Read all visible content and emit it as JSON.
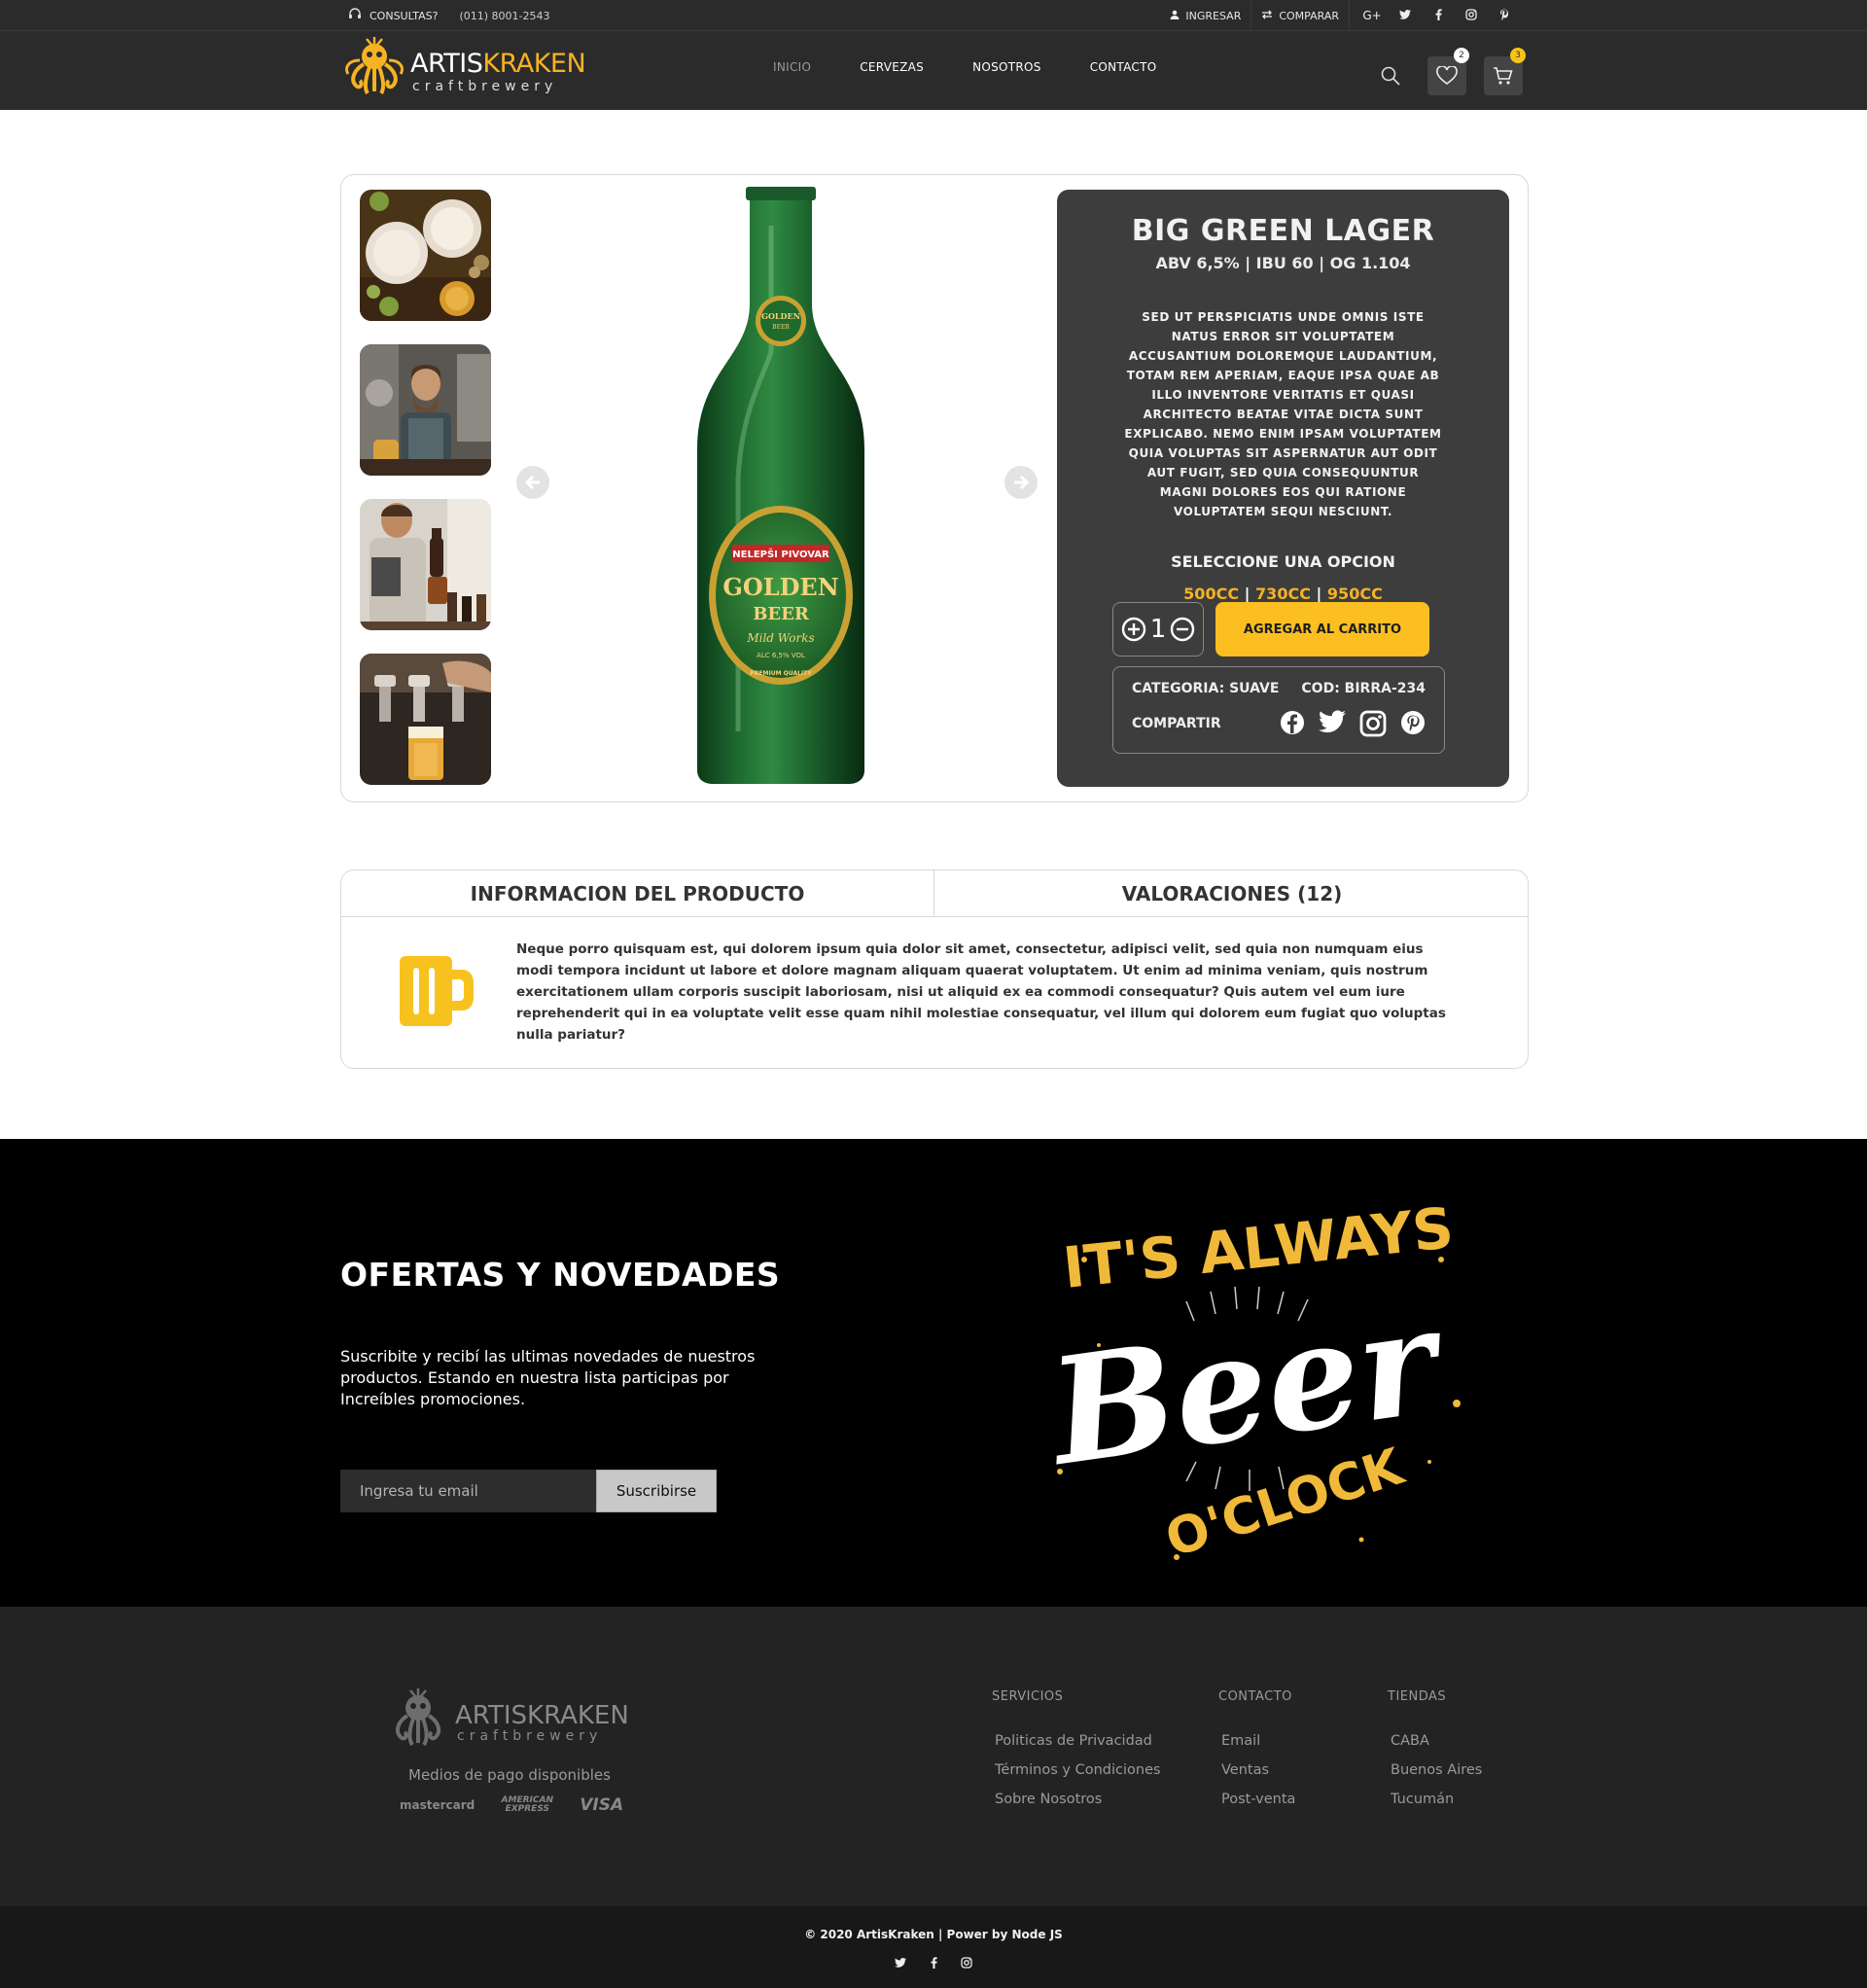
{
  "topbar": {
    "consultas_label": "CONSULTAS?",
    "phone": "(011) 8001-2543",
    "login_label": "INGRESAR",
    "compare_label": "COMPARAR",
    "social": [
      "G+",
      "t",
      "f",
      "ig",
      "p"
    ]
  },
  "header": {
    "logo_part1": "ARTIS",
    "logo_part2": "KRAKEN",
    "logo_sub": "craftbrewery",
    "nav": [
      "INICIO",
      "CERVEZAS",
      "NOSOTROS",
      "CONTACTO"
    ],
    "wishlist_count": "2",
    "cart_count": "3"
  },
  "product": {
    "name": "BIG GREEN LAGER",
    "specs": "ABV 6,5% | IBU 60 | OG 1.104",
    "description": "SED UT PERSPICIATIS UNDE OMNIS ISTE NATUS ERROR SIT VOLUPTATEM ACCUSANTIUM DOLOREMQUE LAUDANTIUM, TOTAM REM APERIAM, EAQUE IPSA QUAE AB ILLO INVENTORE VERITATIS ET QUASI ARCHITECTO BEATAE VITAE DICTA SUNT EXPLICABO. NEMO ENIM IPSAM VOLUPTATEM QUIA VOLUPTAS SIT ASPERNATUR AUT ODIT AUT FUGIT, SED QUIA CONSEQUUNTUR MAGNI DOLORES EOS QUI RATIONE VOLUPTATEM SEQUI NESCIUNT.",
    "option_title": "SELECCIONE UNA OPCION",
    "options": [
      "500CC",
      "730CC",
      "950CC"
    ],
    "option_separator": " | ",
    "quantity": "1",
    "add_to_cart": "AGREGAR AL CARRITO",
    "category": "CATEGORIA: SUAVE",
    "code": "COD: BIRRA-234",
    "share_label": "COMPARTIR",
    "bottle_label": {
      "brand": "GOLDEN",
      "type": "BEER",
      "script": "Mild Works",
      "abv": "ALC 6,5% VOL",
      "banner": "NELEPŠI PIVOVAR",
      "quality": "PREMIUM QUALITY"
    }
  },
  "tabs": {
    "info_label": "INFORMACION DEL PRODUCTO",
    "reviews_label": "VALORACIONES (12)",
    "body": "Neque porro quisquam est, qui dolorem ipsum quia dolor sit amet, consectetur, adipisci velit, sed quia non numquam eius modi tempora incidunt ut labore et dolore magnam aliquam quaerat voluptatem. Ut enim ad minima veniam, quis nostrum exercitationem ullam corporis suscipit laboriosam, nisi ut aliquid ex ea commodi consequatur? Quis autem vel eum iure reprehenderit qui in ea voluptate velit esse quam nihil molestiae consequatur, vel illum qui dolorem eum fugiat quo voluptas nulla pariatur?"
  },
  "newsletter": {
    "title": "OFERTAS Y NOVEDADES",
    "text": "Suscribite y recibí las ultimas novedades de nuestros productos. Estando en nuestra lista participas por Increíbles promociones.",
    "placeholder": "Ingresa tu email",
    "button": "Suscribirse",
    "art_top": "IT'S ALWAYS",
    "art_main": "Beer",
    "art_bottom": "O'CLOCK"
  },
  "footer": {
    "logo_text": "ARTISKRAKEN",
    "logo_sub": "craftbrewery",
    "payment_title": "Medios de pago disponibles",
    "payment_methods": [
      "mastercard",
      "AMERICAN EXPRESS",
      "VISA"
    ],
    "columns": [
      {
        "title": "SERVICIOS",
        "links": [
          "Politicas de Privacidad",
          "Términos y Condiciones",
          "Sobre Nosotros"
        ]
      },
      {
        "title": "CONTACTO",
        "links": [
          "Email",
          "Ventas",
          "Post-venta"
        ]
      },
      {
        "title": "TIENDAS",
        "links": [
          "CABA",
          "Buenos Aires",
          "Tucumán"
        ]
      }
    ],
    "copyright": "© 2020 ArtisKraken | Power by Node JS",
    "social": [
      "t",
      "f",
      "ig"
    ]
  },
  "colors": {
    "accent": "#f5b324",
    "button_yellow": "#fcbf22",
    "header_bg": "#2b2b2b",
    "panel_bg": "#3d3d3d",
    "newsletter_bg": "#000000",
    "footer_bg": "#232323"
  }
}
